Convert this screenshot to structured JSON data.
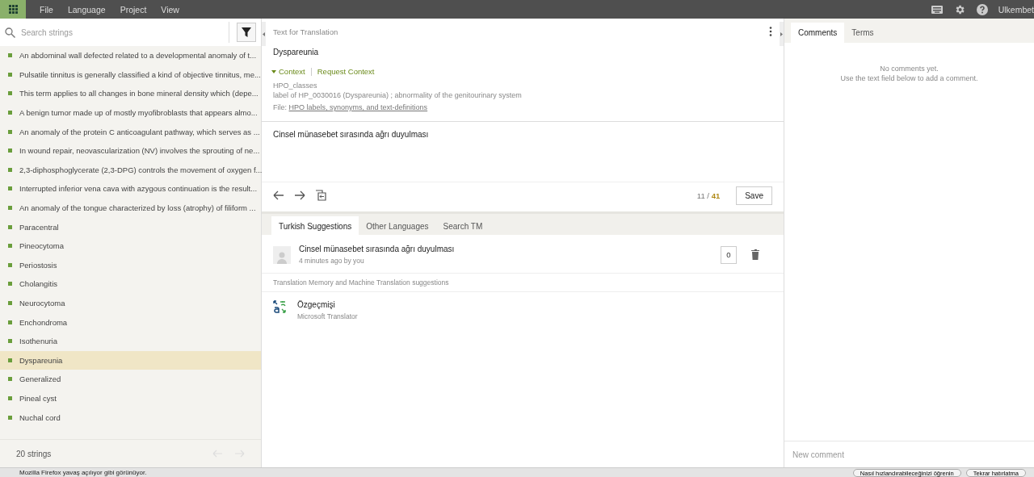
{
  "menu_bar": {
    "items": [
      "File",
      "Language",
      "Project",
      "View"
    ],
    "user": "Ulkembet"
  },
  "sidebar": {
    "search": {
      "placeholder": "Search strings"
    },
    "items": [
      {
        "text": "An abdominal wall defected related to a developmental anomaly of t...",
        "selected": false
      },
      {
        "text": "Pulsatile tinnitus is generally classified a kind of objective tinnitus, me...",
        "selected": false
      },
      {
        "text": "This term applies to all changes in bone mineral density which (depe...",
        "selected": false
      },
      {
        "text": "A benign tumor made up of mostly myofibroblasts that appears almo...",
        "selected": false
      },
      {
        "text": "An anomaly of the protein C anticoagulant pathway, which serves as ...",
        "selected": false
      },
      {
        "text": "In wound repair, neovascularization (NV) involves the sprouting of ne...",
        "selected": false
      },
      {
        "text": "2,3-diphosphoglycerate (2,3-DPG) controls the movement of oxygen f...",
        "selected": false
      },
      {
        "text": "Interrupted inferior vena cava with azygous continuation is the result...",
        "selected": false
      },
      {
        "text": "An anomaly of the tongue characterized by loss (atrophy) of filiform ...",
        "selected": false
      },
      {
        "text": "Paracentral",
        "selected": false
      },
      {
        "text": "Pineocytoma",
        "selected": false
      },
      {
        "text": "Periostosis",
        "selected": false
      },
      {
        "text": "Cholangitis",
        "selected": false
      },
      {
        "text": "Neurocytoma",
        "selected": false
      },
      {
        "text": "Enchondroma",
        "selected": false
      },
      {
        "text": "Isothenuria",
        "selected": false
      },
      {
        "text": "Dyspareunia",
        "selected": true
      },
      {
        "text": "Generalized",
        "selected": false
      },
      {
        "text": "Pineal cyst",
        "selected": false
      },
      {
        "text": "Nuchal cord",
        "selected": false
      }
    ],
    "count": "20 strings"
  },
  "editor": {
    "title": "Text for Translation",
    "source": "Dyspareunia",
    "context": {
      "label": "Context",
      "expanded": true,
      "request_link": "Request Context",
      "lines": [
        "HPO_classes",
        "label of HP_0030016 (Dyspareunia) ; abnormality of the genitourinary system"
      ],
      "file_label": "File:",
      "file_link": "HPO labels, synonyms, and text-definitions"
    },
    "translation": "Cinsel münasebet sırasında ağrı duyulması",
    "counter": {
      "current": "11 /",
      "total": "41"
    },
    "save": "Save"
  },
  "suggestions": {
    "tabs": [
      {
        "label": "Turkish Suggestions",
        "selected": true
      },
      {
        "label": "Other Languages",
        "selected": false
      },
      {
        "label": "Search TM",
        "selected": false
      }
    ],
    "items": [
      {
        "text": "Cinsel münasebet sırasında ağrı duyulması",
        "meta": "4 minutes ago by you",
        "votes": "0"
      }
    ],
    "section_label": "Translation Memory and Machine Translation suggestions",
    "machine": [
      {
        "text": "Özgeçmişi",
        "source": "Microsoft Translator"
      }
    ]
  },
  "comments_panel": {
    "tabs": [
      {
        "label": "Comments",
        "selected": true
      },
      {
        "label": "Terms",
        "selected": false
      }
    ],
    "empty_title": "No comments yet.",
    "empty_hint": "Use the text field below to add a comment.",
    "new_comment": {
      "placeholder": "New comment"
    }
  },
  "notification": {
    "message": "Mozilla Firefox yavaş açılıyor gibi görünüyor.",
    "buttons": [
      "Nasıl hızlandırabileceğinizi öğrenin",
      "Tekrar hatırlatma"
    ]
  }
}
